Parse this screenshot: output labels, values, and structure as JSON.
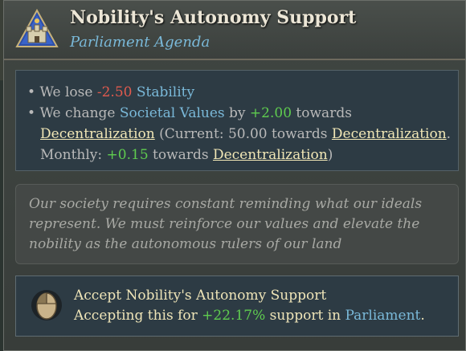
{
  "tooltip": {
    "title": "Nobility's Autonomy Support",
    "subtitle": "Parliament Agenda",
    "icon": "estate-castle-icon"
  },
  "effects": {
    "line1": {
      "prefix": "We lose ",
      "value": "-2.50",
      "target": "Stability"
    },
    "line2": {
      "prefix": "We change ",
      "target": "Societal Values",
      "by": " by ",
      "value": "+2.00",
      "towards": " towards"
    },
    "line3": {
      "direction": "Decentralization",
      "current_prefix": " (Current: 50.00 towards ",
      "direction2": "Decentralization",
      "end": "."
    },
    "line4": {
      "prefix": "Monthly: ",
      "value": "+0.15",
      "towards": " towards ",
      "direction": "Decentralization",
      "end": ")"
    }
  },
  "flavor": {
    "line1": "Our society requires constant reminding what our ideals",
    "line2": "represent. We must reinforce our values and elevate the",
    "line3": "nobility as the autonomous rulers of our land"
  },
  "action": {
    "icon": "mouse-left-click-icon",
    "title": "Accept Nobility's Autonomy Support",
    "desc_prefix": "Accepting this for ",
    "desc_value": "+22.17%",
    "desc_mid": " support in ",
    "desc_target": "Parliament",
    "desc_end": "."
  },
  "colors": {
    "negative": "#e05a4e",
    "positive": "#5fcc4f",
    "link": "#7ab9d9",
    "highlight": "#f1e7b6"
  }
}
